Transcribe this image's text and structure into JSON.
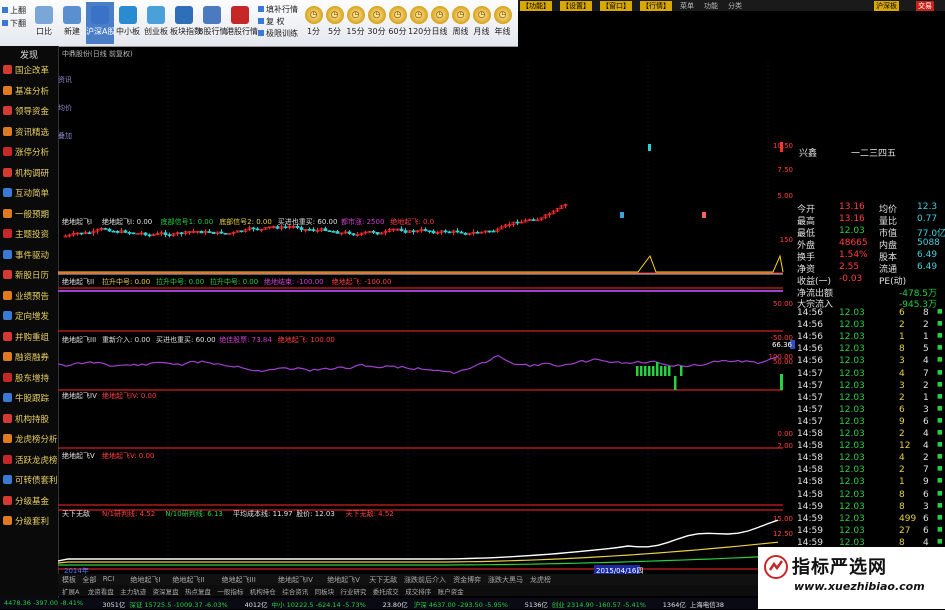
{
  "toolbar": {
    "top_left": [
      {
        "label": "上翻"
      },
      {
        "label": "下翻"
      }
    ],
    "buttons": [
      {
        "label": "口比",
        "color": "#7aa7d8"
      },
      {
        "label": "新建",
        "color": "#5c8fcf"
      },
      {
        "label": "沪深A股",
        "color": "#3a72c8",
        "selected": true
      },
      {
        "label": "中小板",
        "color": "#2b8bd0"
      },
      {
        "label": "创业板",
        "color": "#4aa0d8"
      },
      {
        "label": "板块指数",
        "color": "#2e6fb8"
      },
      {
        "label": "B股行情",
        "color": "#4b7ac0"
      },
      {
        "label": "港股行情",
        "color": "#c62828"
      }
    ],
    "small": [
      "填补行情",
      "复 权",
      "极限训练"
    ],
    "periods": [
      "1分",
      "5分",
      "15分",
      "30分",
      "60分",
      "120分",
      "日线",
      "周线",
      "月线",
      "年线"
    ]
  },
  "top_menu": {
    "items": [
      "【功能】",
      "【设置】",
      "【窗口】",
      "【行情】",
      "菜单",
      "功能",
      "分类"
    ],
    "login": "沪深板",
    "login2": "交易"
  },
  "sidebar": {
    "title": "发现",
    "items": [
      {
        "label": "国企改革",
        "color": "#d43a2f"
      },
      {
        "label": "基准分析",
        "color": "#e07a20"
      },
      {
        "label": "领导资金",
        "color": "#d43a2f"
      },
      {
        "label": "资讯精选",
        "color": "#e07a20"
      },
      {
        "label": "涨停分析",
        "color": "#c62828"
      },
      {
        "label": "机构调研",
        "color": "#d43a2f"
      },
      {
        "label": "互动简单",
        "color": "#3a7ad4"
      },
      {
        "label": "一般预期",
        "color": "#e07a20"
      },
      {
        "label": "主题投资",
        "color": "#c62828"
      },
      {
        "label": "事件驱动",
        "color": "#3a7ad4"
      },
      {
        "label": "新股日历",
        "color": "#d43a2f"
      },
      {
        "label": "业绩预告",
        "color": "#e07a20"
      },
      {
        "label": "定向增发",
        "color": "#3a7ad4"
      },
      {
        "label": "并购重组",
        "color": "#d43a2f"
      },
      {
        "label": "融资融券",
        "color": "#e07a20"
      },
      {
        "label": "股东增持",
        "color": "#c62828"
      },
      {
        "label": "牛股跟踪",
        "color": "#3a7ad4"
      },
      {
        "label": "机构持股",
        "color": "#d43a2f"
      },
      {
        "label": "龙虎榜分析",
        "color": "#e07a20"
      },
      {
        "label": "活跃龙虎榜",
        "color": "#c62828"
      },
      {
        "label": "可转债套利",
        "color": "#3a7ad4"
      },
      {
        "label": "分级基金",
        "color": "#d43a2f"
      },
      {
        "label": "分级套利",
        "color": "#e07a20"
      }
    ]
  },
  "chart": {
    "title": "中鼎股份(日线 前复权)",
    "side_labels": [
      "资讯",
      "均价",
      "叠加"
    ],
    "panel1": {
      "name": "绝地起飞I",
      "items": [
        {
          "text": "绝地起飞I: 0.00",
          "color": "#e0e0e0"
        },
        {
          "text": "底部信号1: 0.00",
          "color": "#26d040"
        },
        {
          "text": "底部信号2: 0.00",
          "color": "#e8d040"
        },
        {
          "text": "买进也重买: 60.00",
          "color": "#e0e0e0"
        },
        {
          "text": "都市涨: 2500",
          "color": "#d040d0"
        },
        {
          "text": "绝地起飞: 0.0",
          "color": "#ff4040"
        }
      ]
    },
    "panel2": {
      "name": "绝地起飞II",
      "items": [
        {
          "text": "拉升中号: 0.00",
          "color": "#e8d040"
        },
        {
          "text": "拉升中号: 0.00",
          "color": "#26d040"
        },
        {
          "text": "拉升中号: 0.00",
          "color": "#26d040"
        },
        {
          "text": "绝地结束: -100.00",
          "color": "#d040d0"
        },
        {
          "text": "绝地起飞: -100.00",
          "color": "#ff4040"
        }
      ]
    },
    "panel3": {
      "name": "绝地起飞III",
      "items": [
        {
          "text": "重新介入: 0.00",
          "color": "#e0e0e0"
        },
        {
          "text": "买进也重买: 60.00",
          "color": "#e0e0e0"
        },
        {
          "text": "绝佳股票: 73.84",
          "color": "#d040d0"
        },
        {
          "text": "绝地起飞: 100.00",
          "color": "#ff4040"
        }
      ]
    },
    "panel4": {
      "name": "绝地起飞IV",
      "items": [
        {
          "text": "绝地起飞IV: 0.00",
          "color": "#ff4040"
        }
      ]
    },
    "panel5": {
      "name": "绝地起飞V",
      "items": [
        {
          "text": "绝地起飞V: 0.00",
          "color": "#ff4040"
        }
      ]
    },
    "panel6": {
      "name": "天下无敌",
      "items": [
        {
          "text": "N/1研判线: 4.52",
          "color": "#ff4040"
        },
        {
          "text": "N/10研判线: 6.13",
          "color": "#26d040"
        },
        {
          "text": "平均成本线: 11.97",
          "color": "#e0e0e0"
        },
        {
          "text": "股价: 12.03",
          "color": "#e0e0e0"
        },
        {
          "text": "天下无敌: 4.52",
          "color": "#ff4040"
        }
      ]
    },
    "right_axis": [
      {
        "label": "10.50"
      },
      {
        "label": "7.50"
      },
      {
        "label": "5.00"
      },
      {
        "label": "150"
      },
      {
        "label": "50.00"
      },
      {
        "label": "-50.00"
      },
      {
        "label": "100.00"
      },
      {
        "label": "50.00"
      },
      {
        "label": "0.00"
      },
      {
        "label": "2.00"
      },
      {
        "label": "15.00"
      },
      {
        "label": "12.50"
      }
    ],
    "marker_value": "66.36",
    "date_left": "2014年",
    "date_highlight": "2015/04/16四"
  },
  "quote": {
    "header": "兴鑫",
    "header_right": "一二三四五",
    "rows": [
      {
        "k": "今开",
        "v": "13.16",
        "k2": "均价",
        "v2": "12.3"
      },
      {
        "k": "最高",
        "v": "13.16",
        "k2": "量比",
        "v2": "0.77"
      },
      {
        "k": "最低",
        "v": "12.03",
        "k2": "市值",
        "v2": "77.0亿"
      },
      {
        "k": "外盘",
        "v": "48665",
        "k2": "内盘",
        "v2": "5088"
      },
      {
        "k": "换手",
        "v": "1.54%",
        "k2": "股本",
        "v2": "6.49"
      },
      {
        "k": "净资",
        "v": "2.55",
        "k2": "流通",
        "v2": "6.49"
      },
      {
        "k": "收益(一)",
        "v": "-0.03",
        "k2": "PE(动)",
        "v2": ""
      }
    ],
    "flow": [
      {
        "k": "净流出额",
        "v": "-478.5万"
      },
      {
        "k": "大宗流入",
        "v": "-945.3万"
      }
    ],
    "ticks": [
      {
        "t": "14:56",
        "p": "12.03",
        "v": "6",
        "n": "8"
      },
      {
        "t": "14:56",
        "p": "12.03",
        "v": "2",
        "n": "2"
      },
      {
        "t": "14:56",
        "p": "12.03",
        "v": "1",
        "n": "1"
      },
      {
        "t": "14:56",
        "p": "12.03",
        "v": "8",
        "n": "5"
      },
      {
        "t": "14:56",
        "p": "12.03",
        "v": "3",
        "n": "4"
      },
      {
        "t": "14:57",
        "p": "12.03",
        "v": "4",
        "n": "7"
      },
      {
        "t": "14:57",
        "p": "12.03",
        "v": "3",
        "n": "2"
      },
      {
        "t": "14:57",
        "p": "12.03",
        "v": "2",
        "n": "1"
      },
      {
        "t": "14:57",
        "p": "12.03",
        "v": "6",
        "n": "3"
      },
      {
        "t": "14:57",
        "p": "12.03",
        "v": "9",
        "n": "6"
      },
      {
        "t": "14:58",
        "p": "12.03",
        "v": "2",
        "n": "4"
      },
      {
        "t": "14:58",
        "p": "12.03",
        "v": "12",
        "n": "4"
      },
      {
        "t": "14:58",
        "p": "12.03",
        "v": "4",
        "n": "2"
      },
      {
        "t": "14:58",
        "p": "12.03",
        "v": "2",
        "n": "7"
      },
      {
        "t": "14:58",
        "p": "12.03",
        "v": "1",
        "n": "9"
      },
      {
        "t": "14:58",
        "p": "12.03",
        "v": "8",
        "n": "6"
      },
      {
        "t": "14:59",
        "p": "12.03",
        "v": "8",
        "n": "3"
      },
      {
        "t": "14:59",
        "p": "12.03",
        "v": "499",
        "n": "6"
      },
      {
        "t": "14:59",
        "p": "12.03",
        "v": "27",
        "n": "6"
      },
      {
        "t": "14:59",
        "p": "12.03",
        "v": "8",
        "n": "4"
      },
      {
        "t": "14:59",
        "p": "12.03",
        "v": "4",
        "n": "3"
      },
      {
        "t": "14:59",
        "p": "12.03",
        "v": "6",
        "n": "6"
      }
    ]
  },
  "tabs": [
    "模板",
    "全部",
    "RCI",
    "绝地起飞I",
    "绝地起飞II",
    "绝地起飞III",
    "绝地起飞IV",
    "绝地起飞V",
    "天下无敌",
    "涨跌前后介入",
    "资金博弈",
    "涨跌大黑马",
    "龙虎榜"
  ],
  "tabs2": [
    "扩展A",
    "龙资看盘",
    "主力轨迹",
    "资深复盘",
    "热点复盘",
    "一般指标",
    "机构持仓",
    "综合资讯",
    "同板块",
    "行业研究",
    "委托成交",
    "成交排序",
    "账户资金"
  ],
  "status": [
    {
      "text": "4478.36 -397.00 -8.41%",
      "color": "#26d040"
    },
    {
      "text": "3051亿",
      "color": "#e0e0e0"
    },
    {
      "text": "深证 15725.5 -1009.37 -6.03%",
      "color": "#26d040"
    },
    {
      "text": "4012亿",
      "color": "#e0e0e0"
    },
    {
      "text": "中小 10222.5 -624.14 -5.73%",
      "color": "#26d040"
    },
    {
      "text": "23.80亿",
      "color": "#e0e0e0"
    },
    {
      "text": "沪深 4637.00 -293.50 -5.95%",
      "color": "#26d040"
    },
    {
      "text": "5136亿",
      "color": "#e0e0e0"
    },
    {
      "text": "创业 2314.90 -160.57 -5.41%",
      "color": "#26d040"
    },
    {
      "text": "1364亿",
      "color": "#e0e0e0"
    },
    {
      "text": "上海电信38",
      "color": "#e0e0e0"
    }
  ],
  "watermark": {
    "title": "指标严选网",
    "url": "www.xuezhibiao.com"
  }
}
